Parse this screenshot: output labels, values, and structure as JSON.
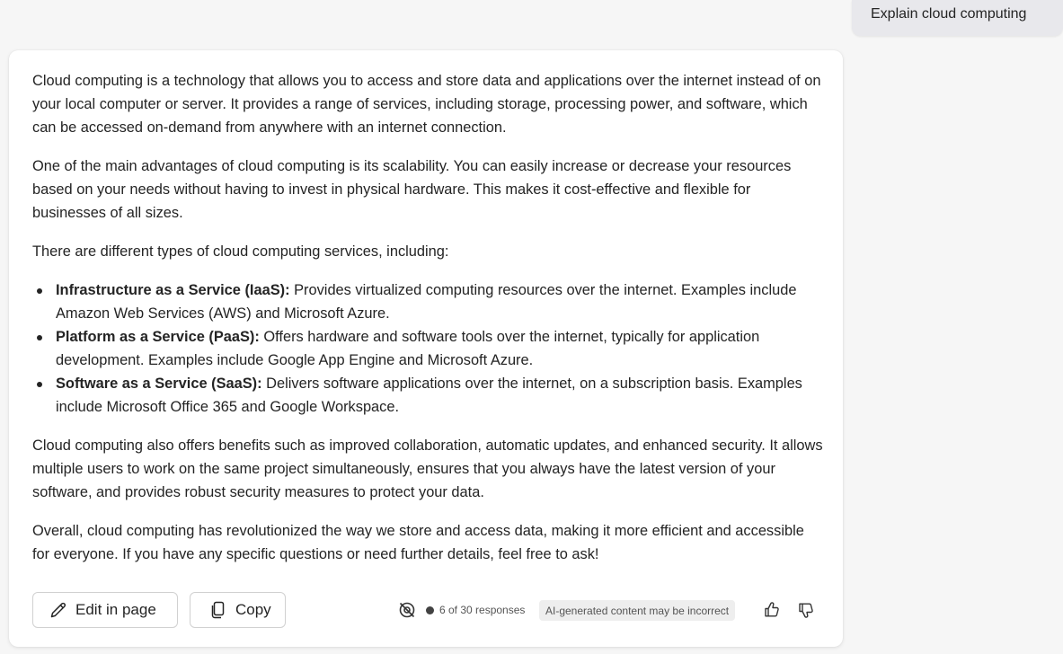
{
  "user_message": "Explain cloud computing",
  "response": {
    "para1": "Cloud computing is a technology that allows you to access and store data and applications over the internet instead of on your local computer or server. It provides a range of services, including storage, processing power, and software, which can be accessed on-demand from anywhere with an internet connection.",
    "para2": "One of the main advantages of cloud computing is its scalability. You can easily increase or decrease your resources based on your needs without having to invest in physical hardware. This makes it cost-effective and flexible for businesses of all sizes.",
    "para3": "There are different types of cloud computing services, including:",
    "list": [
      {
        "term": "Infrastructure as a Service (IaaS):",
        "text": " Provides virtualized computing resources over the internet. Examples include Amazon Web Services (AWS) and Microsoft Azure."
      },
      {
        "term": "Platform as a Service (PaaS):",
        "text": " Offers hardware and software tools over the internet, typically for application development. Examples include Google App Engine and Microsoft Azure."
      },
      {
        "term": "Software as a Service (SaaS):",
        "text": " Delivers software applications over the internet, on a subscription basis. Examples include Microsoft Office 365 and Google Workspace."
      }
    ],
    "para4": "Cloud computing also offers benefits such as improved collaboration, automatic updates, and enhanced security. It allows multiple users to work on the same project simultaneously, ensures that you always have the latest version of your software, and provides robust security measures to protect your data.",
    "para5": "Overall, cloud computing has revolutionized the way we store and access data, making it more efficient and accessible for everyone. If you have any specific questions or need further details, feel free to ask!"
  },
  "footer": {
    "edit_label": "Edit in page",
    "copy_label": "Copy",
    "responses_label": "6 of 30 responses",
    "ai_notice": "AI-generated content may be incorrect"
  },
  "icons": {
    "edit": "pencil-icon",
    "copy": "copy-icon",
    "no_image": "image-off-icon",
    "thumbs_up": "thumbs-up-icon",
    "thumbs_down": "thumbs-down-icon"
  }
}
